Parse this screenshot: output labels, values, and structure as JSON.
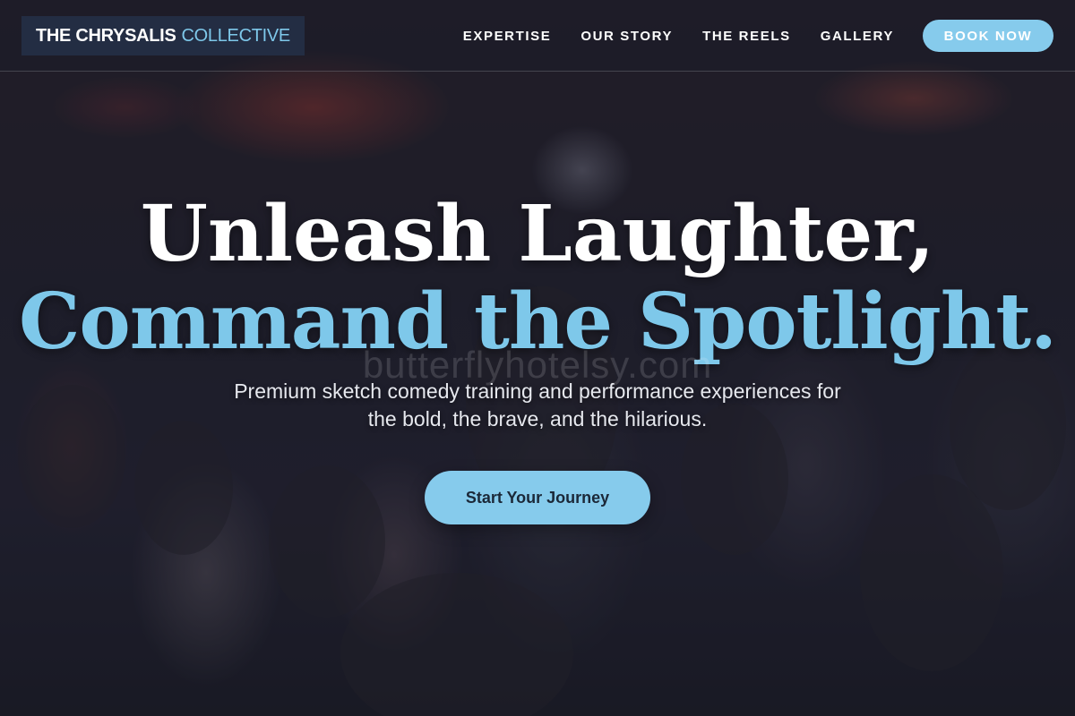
{
  "navbar": {
    "logo": {
      "main": "THE CHRYSALIS",
      "accent": "COLLECTIVE"
    },
    "links": [
      {
        "label": "EXPERTISE"
      },
      {
        "label": "OUR STORY"
      },
      {
        "label": "THE REELS"
      },
      {
        "label": "GALLERY"
      }
    ],
    "cta_label": "BOOK NOW"
  },
  "hero": {
    "headline_line1": "Unleash Laughter,",
    "headline_line2": "Command the Spotlight.",
    "watermark": "butterflyhotelsy.com",
    "subtitle": "Premium sketch comedy training and performance experiences for the bold, the brave, and the hilarious.",
    "cta_label": "Start Your Journey"
  },
  "colors": {
    "accent": "#7ec8ea",
    "button": "#86cbec",
    "overlay": "#161a28"
  }
}
